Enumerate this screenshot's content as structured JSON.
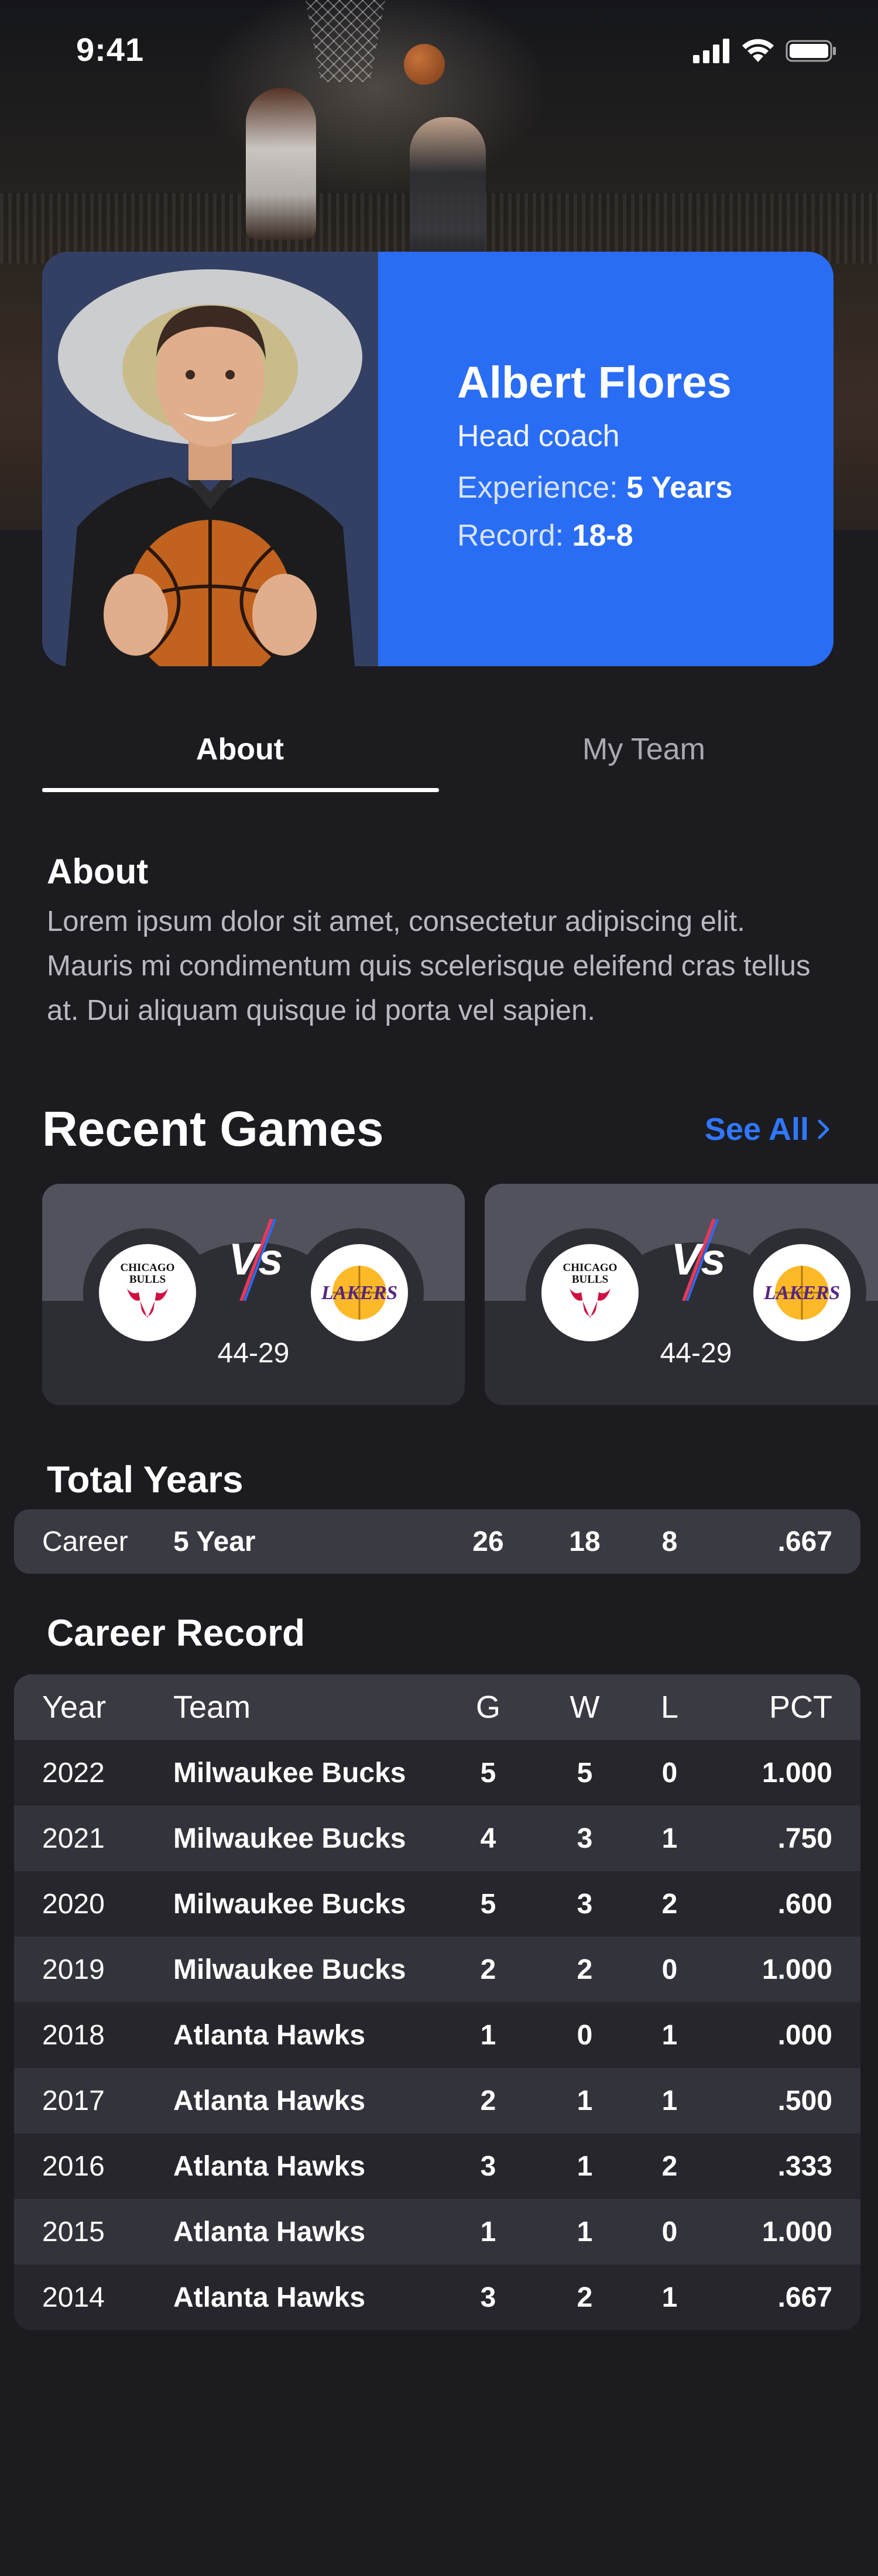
{
  "status_bar": {
    "time": "9:41"
  },
  "coach": {
    "name": "Albert Flores",
    "role": "Head coach",
    "experience_label": "Experience:",
    "experience_value": "5 Years",
    "record_label": "Record:",
    "record_value": "18-8"
  },
  "tabs": [
    {
      "label": "About",
      "active": true
    },
    {
      "label": "My Team",
      "active": false
    }
  ],
  "about": {
    "title": "About",
    "text": "Lorem ipsum dolor sit amet, consectetur adipiscing elit. Mauris mi condimentum quis scelerisque eleifend cras tellus at. Dui aliquam quisque id porta vel sapien."
  },
  "recent_games": {
    "title": "Recent Games",
    "see_all": "See All",
    "games": [
      {
        "home_logo": "CHICAGO BULLS",
        "away_logo": "LAKERS",
        "score": "44-29"
      },
      {
        "home_logo": "CHICAGO BULLS",
        "away_logo": "LAKERS",
        "score": "44-29"
      }
    ]
  },
  "total_years": {
    "title": "Total Years",
    "label": "Career",
    "years": "5 Year",
    "g": "26",
    "w": "18",
    "l": "8",
    "pct": ".667"
  },
  "career_record": {
    "title": "Career Record",
    "headers": {
      "year": "Year",
      "team": "Team",
      "g": "G",
      "w": "W",
      "l": "L",
      "pct": "PCT"
    },
    "rows": [
      {
        "year": "2022",
        "team": "Milwaukee Bucks",
        "g": "5",
        "w": "5",
        "l": "0",
        "pct": "1.000"
      },
      {
        "year": "2021",
        "team": "Milwaukee Bucks",
        "g": "4",
        "w": "3",
        "l": "1",
        "pct": ".750"
      },
      {
        "year": "2020",
        "team": "Milwaukee Bucks",
        "g": "5",
        "w": "3",
        "l": "2",
        "pct": ".600"
      },
      {
        "year": "2019",
        "team": "Milwaukee Bucks",
        "g": "2",
        "w": "2",
        "l": "0",
        "pct": "1.000"
      },
      {
        "year": "2018",
        "team": "Atlanta Hawks",
        "g": "1",
        "w": "0",
        "l": "1",
        "pct": ".000"
      },
      {
        "year": "2017",
        "team": "Atlanta Hawks",
        "g": "2",
        "w": "1",
        "l": "1",
        "pct": ".500"
      },
      {
        "year": "2016",
        "team": "Atlanta Hawks",
        "g": "3",
        "w": "1",
        "l": "2",
        "pct": ".333"
      },
      {
        "year": "2015",
        "team": "Atlanta Hawks",
        "g": "1",
        "w": "1",
        "l": "0",
        "pct": "1.000"
      },
      {
        "year": "2014",
        "team": "Atlanta Hawks",
        "g": "3",
        "w": "2",
        "l": "1",
        "pct": ".667"
      }
    ]
  },
  "colors": {
    "background": "#1b1b20",
    "accent": "#2a6df5",
    "link": "#2f78ff",
    "card": "#2d2d34",
    "row_alt": "#33333b",
    "bulls_red": "#ce1141",
    "lakers_purple": "#552583",
    "lakers_gold": "#fdb927"
  },
  "icons": [
    "cellular-signal-icon",
    "wifi-icon",
    "battery-icon",
    "chevron-right-icon",
    "vs-icon",
    "bulls-logo",
    "lakers-logo"
  ]
}
